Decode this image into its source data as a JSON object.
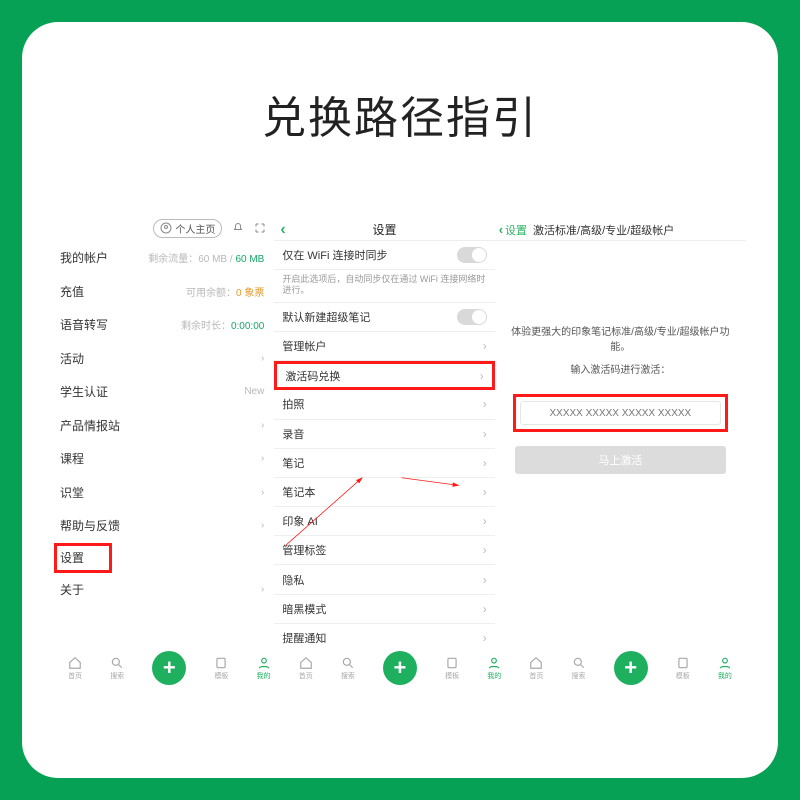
{
  "title": "兑换路径指引",
  "panelA": {
    "head": {
      "profile": "个人主页"
    },
    "rows": [
      {
        "label": "我的帐户",
        "metaPrefix": "剩余流量：",
        "metaVal": "60 MB",
        "metaSep": " / ",
        "metaMax": "60 MB"
      },
      {
        "label": "充值",
        "metaPrefix": "可用余额：",
        "metaVal": "0 象票"
      },
      {
        "label": "语音转写",
        "metaPrefix": "剩余时长：",
        "metaVal": "0:00:00"
      },
      {
        "label": "活动"
      },
      {
        "label": "学生认证",
        "badge": "New"
      },
      {
        "label": "产品情报站"
      },
      {
        "label": "课程"
      },
      {
        "label": "识堂"
      },
      {
        "label": "帮助与反馈"
      },
      {
        "label": "设置",
        "highlighted": true
      },
      {
        "label": "关于"
      }
    ]
  },
  "panelB": {
    "title": "设置",
    "rows": [
      {
        "label": "仅在 WiFi 连接时同步",
        "type": "toggle"
      },
      {
        "sub": "开启此选项后，自动同步仅在通过 WiFi 连接网络时进行。"
      },
      {
        "label": "默认新建超级笔记",
        "type": "toggle"
      },
      {
        "label": "管理帐户"
      },
      {
        "label": "激活码兑换",
        "highlighted": true
      },
      {
        "label": "拍照"
      },
      {
        "label": "录音"
      },
      {
        "label": "笔记"
      },
      {
        "label": "笔记本"
      },
      {
        "label": "印象 AI"
      },
      {
        "label": "管理标签"
      },
      {
        "label": "隐私"
      },
      {
        "label": "暗黑模式"
      },
      {
        "label": "提醒通知"
      }
    ]
  },
  "panelC": {
    "back": "设置",
    "title": "激活标准/高级/专业/超级帐户",
    "line1": "体验更强大的印象笔记标准/高级/专业/超级帐户功能。",
    "line2": "输入激活码进行激活：",
    "placeholder": "XXXXX XXXXX XXXXX XXXXX",
    "button": "马上激活"
  },
  "nav": {
    "items": [
      {
        "k": "home",
        "label": "首页"
      },
      {
        "k": "search",
        "label": "搜索"
      },
      {
        "k": "fab",
        "label": ""
      },
      {
        "k": "tmpl",
        "label": "模板"
      },
      {
        "k": "me",
        "label": "我的"
      }
    ]
  }
}
